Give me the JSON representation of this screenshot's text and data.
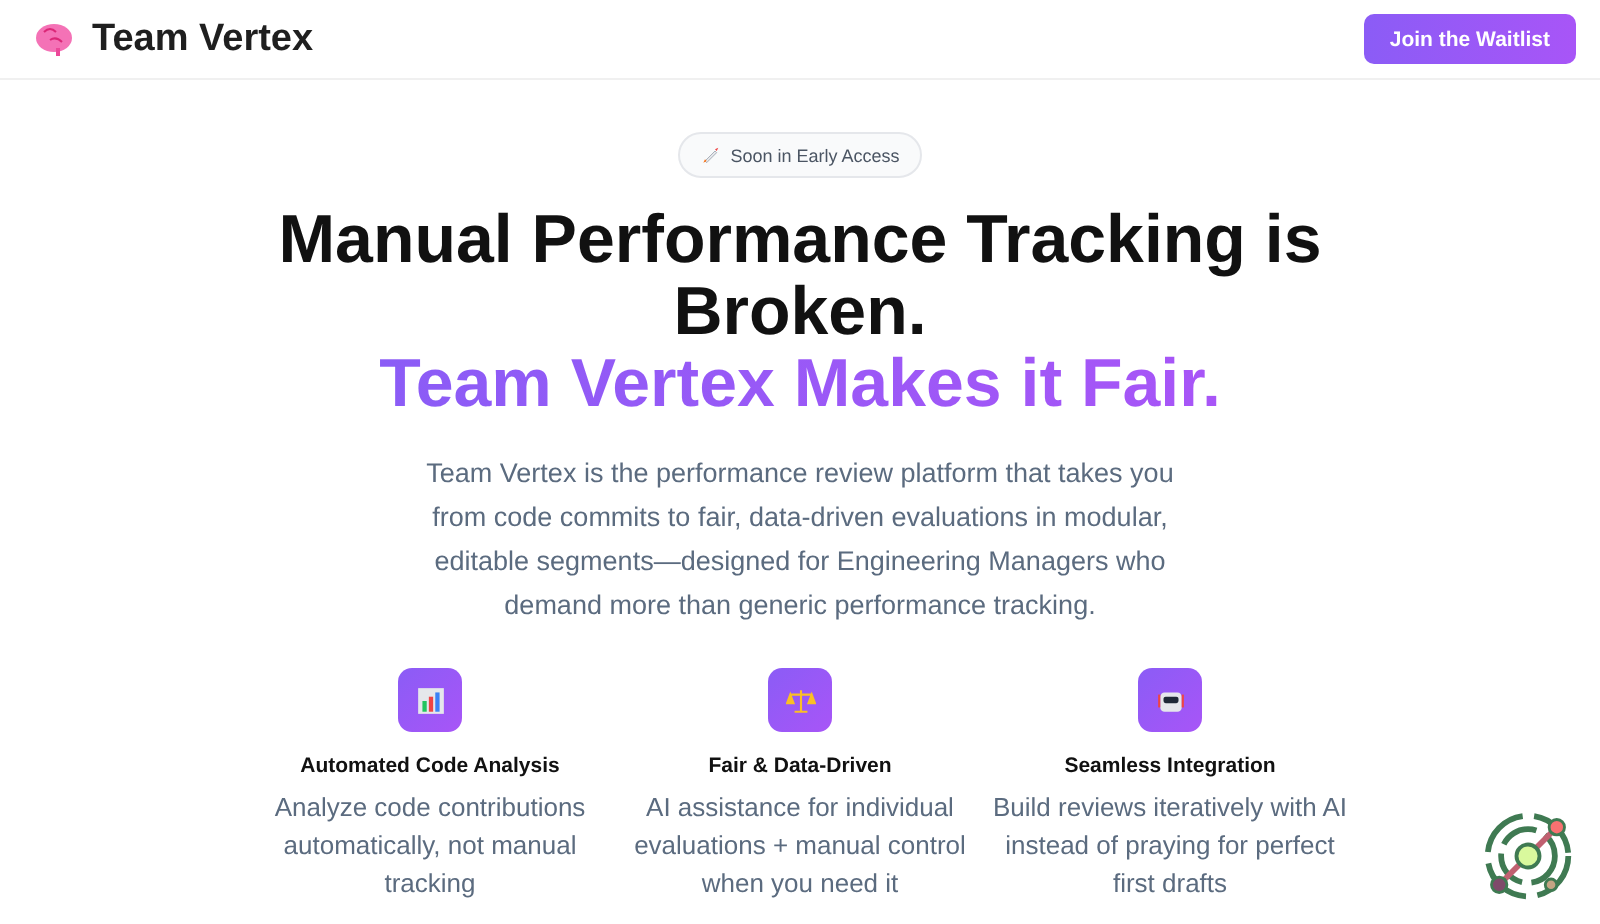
{
  "header": {
    "brand": "Team Vertex",
    "cta": "Join the Waitlist"
  },
  "badge": "Soon in Early Access",
  "headline": {
    "line1": "Manual Performance Tracking is Broken.",
    "line2": "Team Vertex Makes it Fair."
  },
  "description": "Team Vertex is the performance review platform that takes you from code commits to fair, data-driven evaluations in modular, editable segments—designed for Engineering Managers who demand more than generic performance tracking.",
  "features": [
    {
      "kind": "chart",
      "title": "Automated Code Analysis",
      "text": "Analyze code contributions automatically, not manual tracking"
    },
    {
      "kind": "scale",
      "title": "Fair & Data-Driven",
      "text": "AI assistance for individual evaluations + manual control when you need it"
    },
    {
      "kind": "robot",
      "title": "Seamless Integration",
      "text": "Build reviews iteratively with AI instead of praying for perfect first drafts"
    }
  ]
}
